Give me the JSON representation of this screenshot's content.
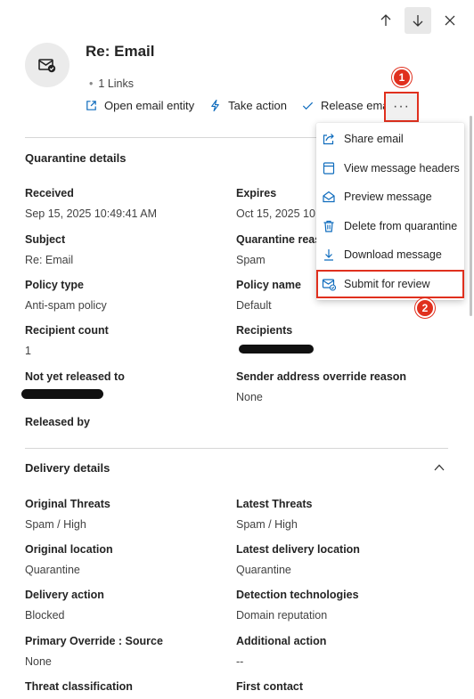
{
  "header": {
    "title": "Re: Email",
    "links": "1 Links"
  },
  "actions": {
    "open_entity": "Open email entity",
    "take_action": "Take action",
    "release_email": "Release email",
    "more": "···"
  },
  "badges": {
    "one": "1",
    "two": "2"
  },
  "quarantine": {
    "title": "Quarantine details",
    "fields": [
      {
        "label": "Received",
        "value": "Sep 15, 2025 10:49:41 AM"
      },
      {
        "label": "Expires",
        "value": "Oct 15, 2025 10:"
      },
      {
        "label": "Subject",
        "value": "Re: Email"
      },
      {
        "label": "Quarantine reas",
        "value": "Spam"
      },
      {
        "label": "Policy type",
        "value": "Anti-spam policy"
      },
      {
        "label": "Policy name",
        "value": "Default"
      },
      {
        "label": "Recipient count",
        "value": "1"
      },
      {
        "label": "Recipients",
        "value": ""
      },
      {
        "label": "Not yet released to",
        "value": ""
      },
      {
        "label": "Sender address override reason",
        "value": "None"
      },
      {
        "label": "Released by",
        "value": ""
      }
    ]
  },
  "delivery": {
    "title": "Delivery details",
    "fields": [
      {
        "label": "Original Threats",
        "value": "Spam / High"
      },
      {
        "label": "Latest Threats",
        "value": "Spam / High"
      },
      {
        "label": "Original location",
        "value": "Quarantine"
      },
      {
        "label": "Latest delivery location",
        "value": "Quarantine"
      },
      {
        "label": "Delivery action",
        "value": "Blocked"
      },
      {
        "label": "Detection technologies",
        "value": "Domain reputation"
      },
      {
        "label": "Primary Override : Source",
        "value": "None"
      },
      {
        "label": "Additional action",
        "value": "--"
      },
      {
        "label": "Threat classification",
        "value": ""
      },
      {
        "label": "First contact",
        "value": ""
      }
    ]
  },
  "menu": {
    "items": [
      {
        "label": "Share email",
        "icon": "share-icon"
      },
      {
        "label": "View message headers",
        "icon": "headers-icon"
      },
      {
        "label": "Preview message",
        "icon": "envelope-open-icon"
      },
      {
        "label": "Delete from quarantine",
        "icon": "trash-icon"
      },
      {
        "label": "Download message",
        "icon": "download-icon"
      },
      {
        "label": "Submit for review",
        "icon": "submit-mail-icon"
      }
    ]
  },
  "colors": {
    "accent": "#0f6cbd",
    "highlight": "#e0301e"
  }
}
